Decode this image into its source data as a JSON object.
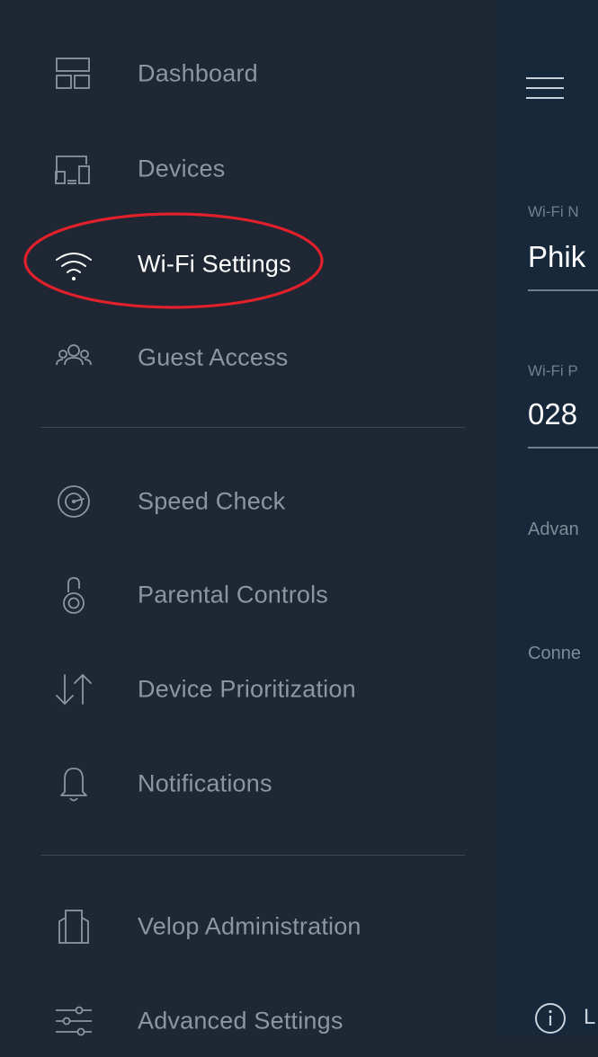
{
  "sidebar": {
    "items": [
      {
        "label": "Dashboard",
        "icon": "dashboard-icon"
      },
      {
        "label": "Devices",
        "icon": "devices-icon"
      },
      {
        "label": "Wi-Fi Settings",
        "icon": "wifi-icon",
        "active": true
      },
      {
        "label": "Guest Access",
        "icon": "guest-access-icon"
      },
      {
        "label": "Speed Check",
        "icon": "speed-check-icon"
      },
      {
        "label": "Parental Controls",
        "icon": "parental-controls-icon"
      },
      {
        "label": "Device Prioritization",
        "icon": "prioritization-arrows-icon"
      },
      {
        "label": "Notifications",
        "icon": "bell-icon"
      },
      {
        "label": "Velop Administration",
        "icon": "velop-node-icon"
      },
      {
        "label": "Advanced Settings",
        "icon": "sliders-icon"
      }
    ]
  },
  "main": {
    "fields": [
      {
        "label": "Wi-Fi N",
        "value": "Phik"
      },
      {
        "label": "Wi-Fi P",
        "value": "028"
      }
    ],
    "links": [
      "Advan",
      "Conne"
    ],
    "footer_text": "L"
  },
  "colors": {
    "drawer_bg": "#1e2733",
    "main_bg": "#17283a",
    "highlight": "#e0202a",
    "active_text": "#ffffff",
    "inactive_text": "#8a97a3"
  }
}
